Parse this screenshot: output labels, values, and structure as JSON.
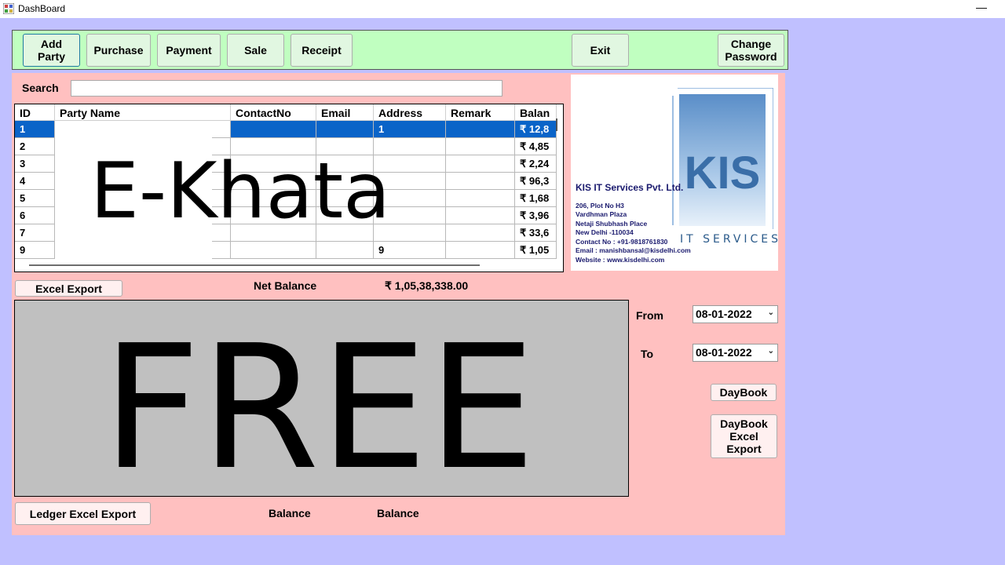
{
  "window": {
    "title": "DashBoard",
    "minimize_glyph": "—"
  },
  "toolbar": {
    "add_party": "Add\nParty",
    "purchase": "Purchase",
    "payment": "Payment",
    "sale": "Sale",
    "receipt": "Receipt",
    "exit": "Exit",
    "change_password": "Change\nPassword"
  },
  "search": {
    "label": "Search",
    "value": ""
  },
  "grid": {
    "columns": [
      "ID",
      "Party Name",
      "ContactNo",
      "Email",
      "Address",
      "Remark",
      "Balan"
    ],
    "rows": [
      [
        "1",
        "",
        "",
        "",
        "1",
        "",
        "₹ 12,8"
      ],
      [
        "2",
        "",
        "",
        "",
        "",
        "",
        "₹ 4,85"
      ],
      [
        "3",
        "",
        "",
        "",
        "",
        "",
        "₹ 2,24"
      ],
      [
        "4",
        "",
        "",
        "",
        "",
        "",
        "₹ 96,3"
      ],
      [
        "5",
        "",
        "",
        "",
        "",
        "",
        "₹ 1,68"
      ],
      [
        "6",
        "",
        "",
        "",
        "",
        "",
        "₹ 3,96"
      ],
      [
        "7",
        "",
        "",
        "",
        "",
        "",
        "₹ 33,6"
      ],
      [
        "9",
        "",
        "",
        "",
        "9",
        "",
        "₹ 1,05"
      ]
    ],
    "watermark": "E-Khata"
  },
  "logo": {
    "company": "KIS IT Services Pvt. Ltd.",
    "lines": [
      "206, Plot No H3",
      "Vardhman Plaza",
      "Netaji Shubhash Place",
      "New Delhi -110034",
      "Contact No : +91-9818761830",
      "Email : manishbansal@kisdelhi.com",
      "Website : www.kisdelhi.com"
    ],
    "brand": "KIS",
    "tagline": "IT SERVICES"
  },
  "excel_export": "Excel Export",
  "net_balance": {
    "label": "Net Balance",
    "value": "₹ 1,05,38,338.00"
  },
  "free_panel": {
    "text": "FREE"
  },
  "dates": {
    "from_label": "From",
    "from_value": "08-01-2022",
    "to_label": "To",
    "to_value": "08-01-2022"
  },
  "daybook": "DayBook",
  "daybook_excel_export": "DayBook\nExcel\nExport",
  "ledger_excel_export": "Ledger Excel Export",
  "footer": {
    "balance1": "Balance",
    "balance2": "Balance"
  },
  "colors": {
    "selected_row": "#0a64c8",
    "toolbar_bg": "#c0ffc0",
    "panel_bg": "#ffc0c0",
    "window_bg": "#c0c0ff"
  }
}
